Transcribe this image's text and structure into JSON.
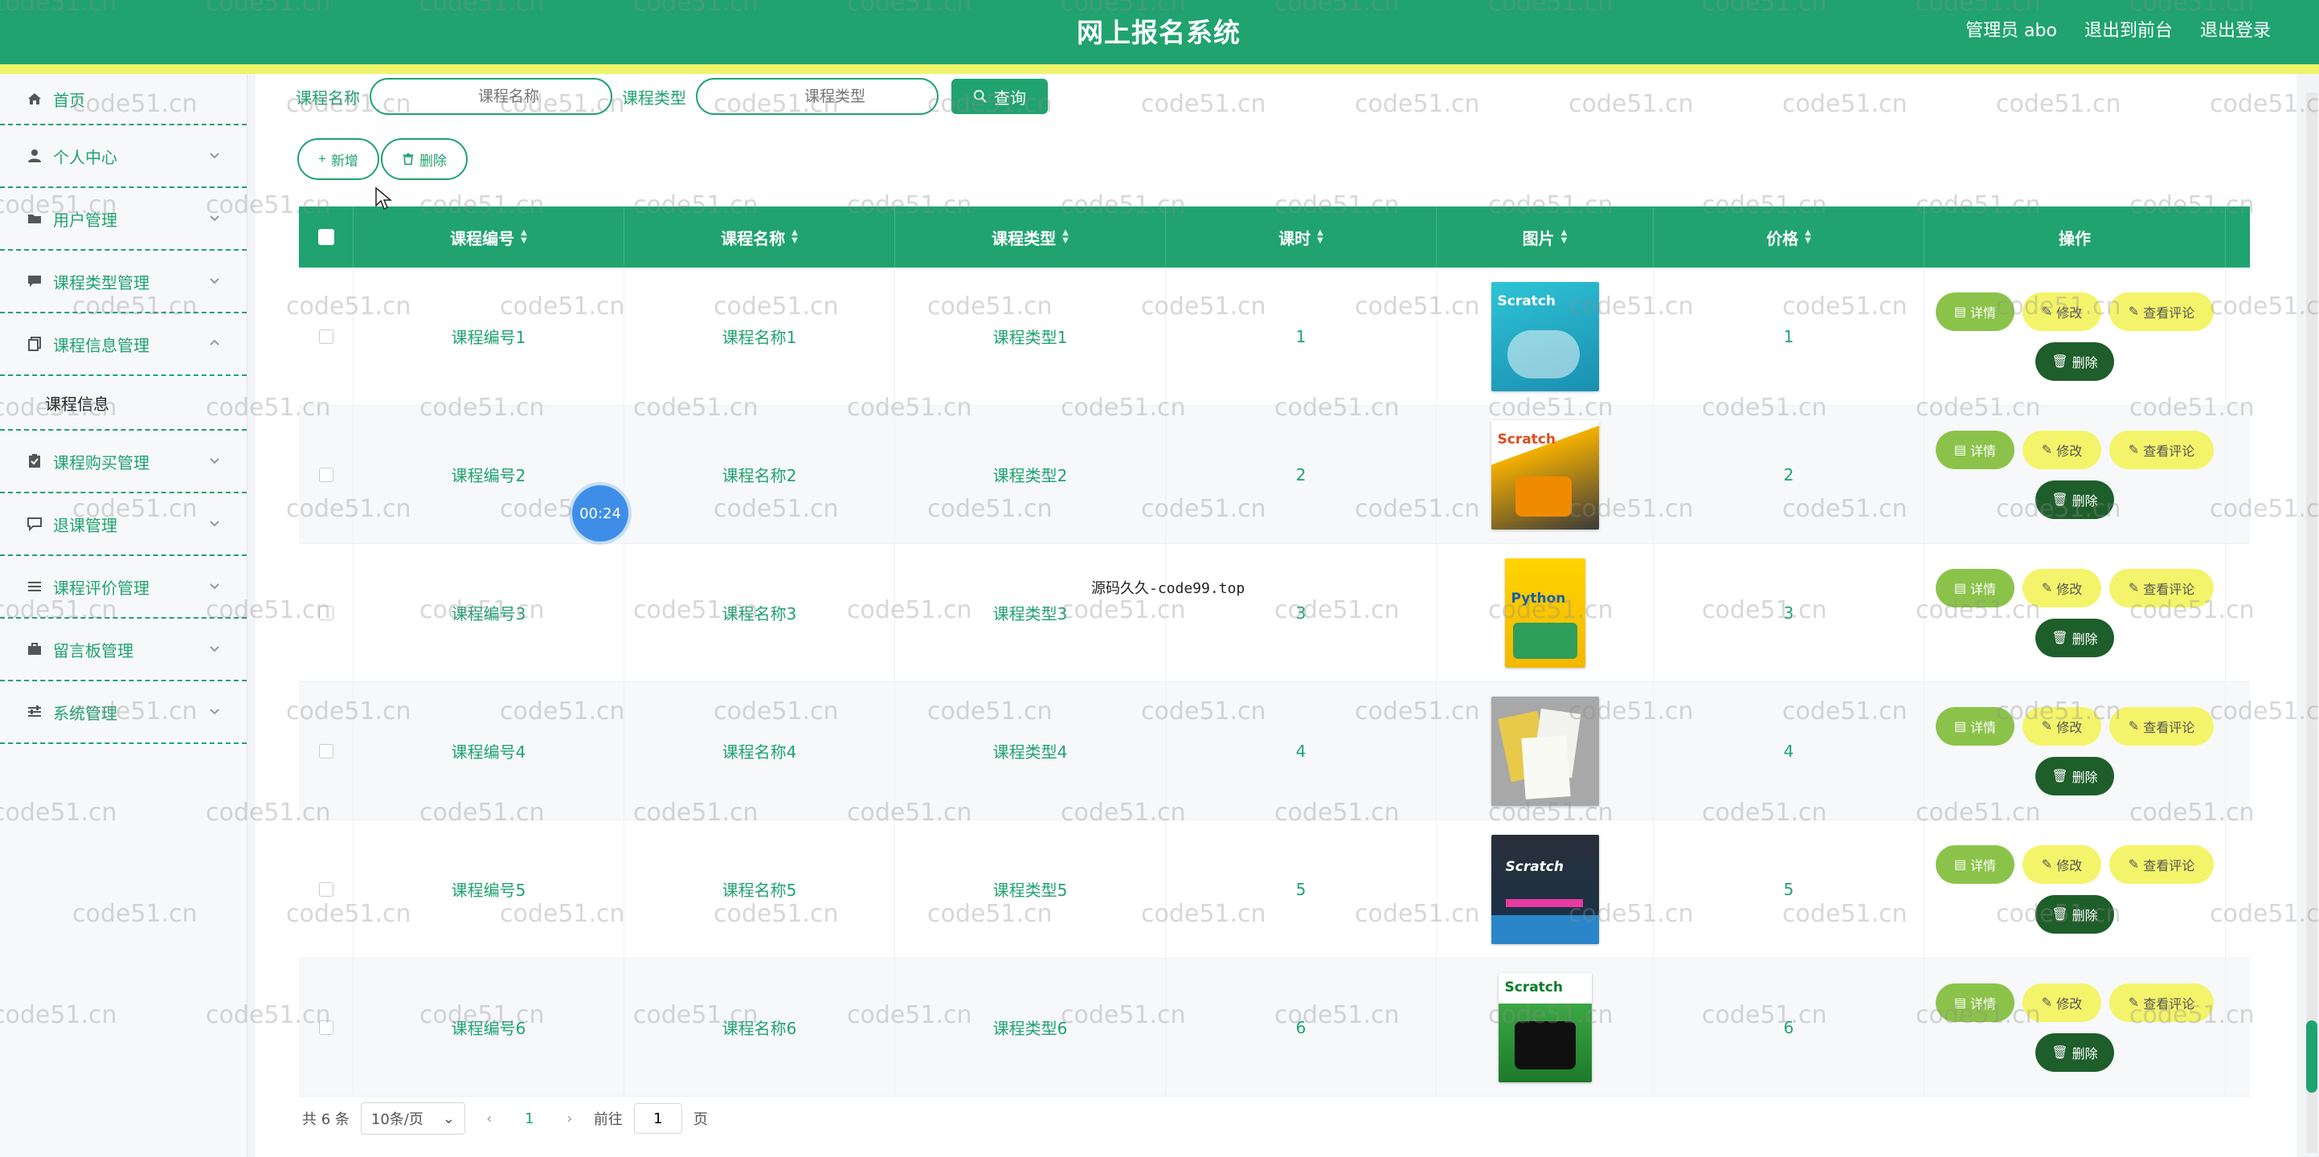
{
  "header": {
    "title": "网上报名系统",
    "user_label": "管理员 abo",
    "back_label": "退出到前台",
    "logout_label": "退出登录"
  },
  "sidebar": {
    "items": [
      {
        "label": "首页",
        "icon": "home-icon",
        "has_children": false
      },
      {
        "label": "个人中心",
        "icon": "user-icon",
        "has_children": true
      },
      {
        "label": "用户管理",
        "icon": "folder-icon",
        "has_children": true
      },
      {
        "label": "课程类型管理",
        "icon": "chat-icon",
        "has_children": true
      },
      {
        "label": "课程信息管理",
        "icon": "copy-icon",
        "has_children": true,
        "expanded": true
      },
      {
        "label": "课程购买管理",
        "icon": "clipboard-icon",
        "has_children": true
      },
      {
        "label": "退课管理",
        "icon": "comment-icon",
        "has_children": true
      },
      {
        "label": "课程评价管理",
        "icon": "list-icon",
        "has_children": true
      },
      {
        "label": "留言板管理",
        "icon": "briefcase-icon",
        "has_children": true
      },
      {
        "label": "系统管理",
        "icon": "sliders-icon",
        "has_children": true
      }
    ],
    "submenu": {
      "label": "课程信息"
    }
  },
  "search": {
    "name_label": "课程名称",
    "name_placeholder": "课程名称",
    "type_label": "课程类型",
    "type_placeholder": "课程类型",
    "query_label": "查询"
  },
  "actions": {
    "add_label": "新增",
    "delete_label": "删除"
  },
  "table": {
    "columns": [
      "课程编号",
      "课程名称",
      "课程类型",
      "课时",
      "图片",
      "价格",
      "操作"
    ],
    "rows": [
      {
        "code": "课程编号1",
        "name": "课程名称1",
        "type": "课程类型1",
        "hours": "1",
        "price": "1",
        "cover": "Scratch"
      },
      {
        "code": "课程编号2",
        "name": "课程名称2",
        "type": "课程类型2",
        "hours": "2",
        "price": "2",
        "cover": "Scratch"
      },
      {
        "code": "课程编号3",
        "name": "课程名称3",
        "type": "课程类型3",
        "hours": "3",
        "price": "3",
        "cover": "Python"
      },
      {
        "code": "课程编号4",
        "name": "课程名称4",
        "type": "课程类型4",
        "hours": "4",
        "price": "4",
        "cover": ""
      },
      {
        "code": "课程编号5",
        "name": "课程名称5",
        "type": "课程类型5",
        "hours": "5",
        "price": "5",
        "cover": "Scratch"
      },
      {
        "code": "课程编号6",
        "name": "课程名称6",
        "type": "课程类型6",
        "hours": "6",
        "price": "6",
        "cover": "Scratch"
      }
    ],
    "row_buttons": {
      "detail": "详情",
      "edit": "修改",
      "review": "查看评论",
      "delete": "删除"
    }
  },
  "pagination": {
    "total": "共 6 条",
    "page_size": "10条/页",
    "current_page": "1",
    "goto_label": "前往",
    "goto_value": "1",
    "page_unit": "页"
  },
  "overlay": {
    "timer": "00:24",
    "center_text": "源码久久-code99.top",
    "watermark": "code51.cn"
  },
  "colors": {
    "primary": "#20a36f",
    "accent_yellow": "#f4f46b",
    "detail_green": "#8bc34a",
    "delete_dark": "#1e5e2a"
  }
}
